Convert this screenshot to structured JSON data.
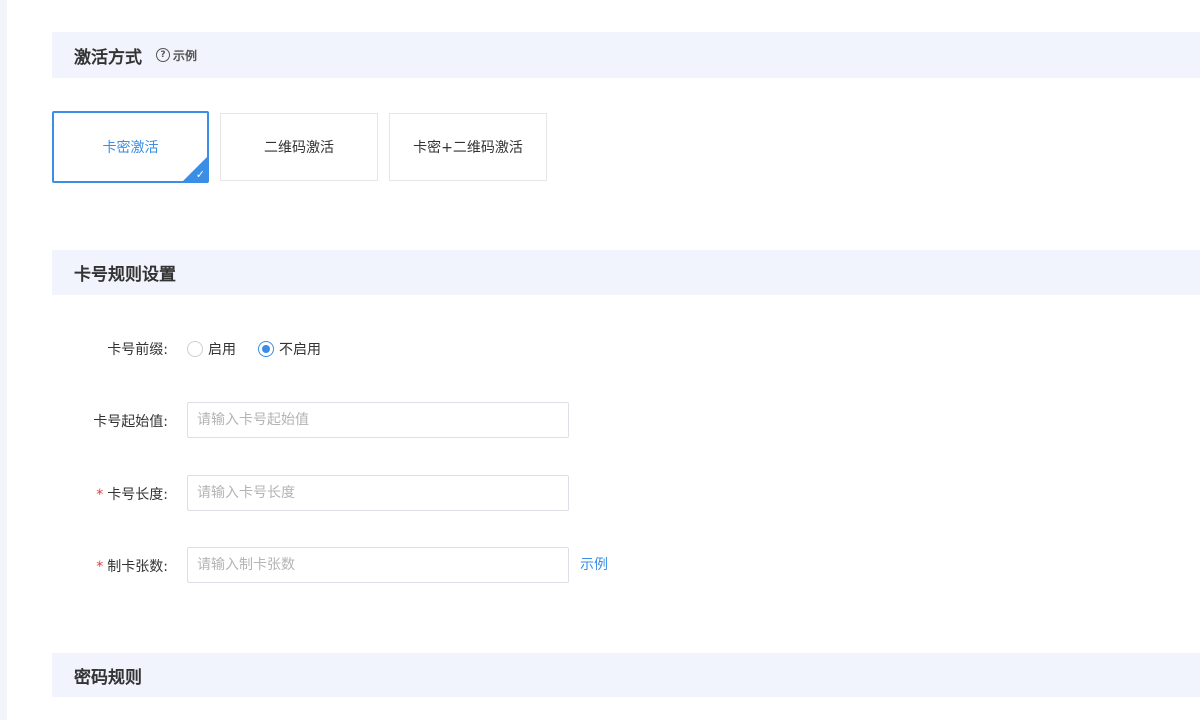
{
  "activation_section": {
    "title": "激活方式",
    "help_label": "示例",
    "help_icon": "question-circle-icon",
    "options": [
      {
        "label": "卡密激活",
        "selected": true
      },
      {
        "label": "二维码激活",
        "selected": false
      },
      {
        "label": "卡密+二维码激活",
        "selected": false
      }
    ]
  },
  "card_rule_section": {
    "title": "卡号规则设置",
    "prefix": {
      "label": "卡号前缀:",
      "options": [
        {
          "label": "启用",
          "checked": false
        },
        {
          "label": "不启用",
          "checked": true
        }
      ]
    },
    "start_value": {
      "label": "卡号起始值:",
      "placeholder": "请输入卡号起始值",
      "value": ""
    },
    "length": {
      "required_mark": "*",
      "label": "卡号长度:",
      "placeholder": "请输入卡号长度",
      "value": ""
    },
    "count": {
      "required_mark": "*",
      "label": "制卡张数:",
      "placeholder": "请输入制卡张数",
      "value": "",
      "example_link": "示例"
    }
  },
  "password_section": {
    "title": "密码规则"
  },
  "colors": {
    "accent": "#3a8ee6",
    "section_bg": "#f1f4fd",
    "required": "#e4393c"
  }
}
